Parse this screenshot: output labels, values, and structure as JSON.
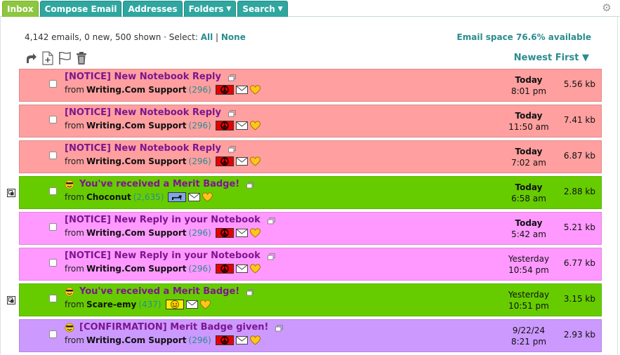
{
  "tabs": [
    {
      "label": "Inbox",
      "active": true,
      "caret": ""
    },
    {
      "label": "Compose Email",
      "active": false,
      "caret": ""
    },
    {
      "label": "Addresses",
      "active": false,
      "caret": ""
    },
    {
      "label": "Folders",
      "active": false,
      "caret": "▼"
    },
    {
      "label": "Search",
      "active": false,
      "caret": "▼"
    }
  ],
  "summary": {
    "counts": "4,142 emails, 0 new, 500 shown · Select: ",
    "select_all": "All",
    "separator": " | ",
    "select_none": "None"
  },
  "space": "Email space 76.6% available",
  "sort": "Newest First ▼",
  "toolbar": [
    "reply-icon",
    "add-to-folder-icon",
    "flag-icon",
    "trash-icon"
  ],
  "messages": [
    {
      "subject": "[NOTICE] New Notebook Reply",
      "sender": "Writing.Com Support",
      "count": "(296)",
      "date": "Today",
      "time": "8:01 pm",
      "size": "5.56 kb",
      "bg": "#ff9f9f",
      "badge": "peace",
      "smiley": false,
      "rowicon": false
    },
    {
      "subject": "[NOTICE] New Notebook Reply",
      "sender": "Writing.Com Support",
      "count": "(296)",
      "date": "Today",
      "time": "11:50 am",
      "size": "7.41 kb",
      "bg": "#ff9f9f",
      "badge": "peace",
      "smiley": false,
      "rowicon": false
    },
    {
      "subject": "[NOTICE] New Notebook Reply",
      "sender": "Writing.Com Support",
      "count": "(296)",
      "date": "Today",
      "time": "7:02 am",
      "size": "6.87 kb",
      "bg": "#ff9f9f",
      "badge": "peace",
      "smiley": false,
      "rowicon": false
    },
    {
      "subject": "You've received a Merit Badge!",
      "sender": "Choconut",
      "count": "(2,635)",
      "date": "Today",
      "time": "6:58 am",
      "size": "2.88 kb",
      "bg": "#66cc00",
      "badge": "dog",
      "smiley": true,
      "rowicon": true
    },
    {
      "subject": "[NOTICE] New Reply in your Notebook",
      "sender": "Writing.Com Support",
      "count": "(296)",
      "date": "Today",
      "time": "5:42 am",
      "size": "5.21 kb",
      "bg": "#ff99ff",
      "badge": "peace",
      "smiley": false,
      "rowicon": false
    },
    {
      "subject": "[NOTICE] New Reply in your Notebook",
      "sender": "Writing.Com Support",
      "count": "(296)",
      "date": "Yesterday",
      "time": "10:54 pm",
      "size": "6.77 kb",
      "bg": "#ff99ff",
      "badge": "peace",
      "smiley": false,
      "rowicon": false
    },
    {
      "subject": "You've received a Merit Badge!",
      "sender": "Scare-emy",
      "count": "(437)",
      "date": "Yesterday",
      "time": "10:51 pm",
      "size": "3.15 kb",
      "bg": "#66cc00",
      "badge": "smile",
      "smiley": true,
      "rowicon": true
    },
    {
      "subject": "[CONFIRMATION] Merit Badge given!",
      "sender": "Writing.Com Support",
      "count": "(296)",
      "date": "9/22/24",
      "time": "8:21 pm",
      "size": "2.93 kb",
      "bg": "#cc99ff",
      "badge": "peace",
      "smiley": true,
      "rowicon": false
    }
  ],
  "from_label": "from",
  "colors": {
    "accent": "#2b8d8f",
    "subject": "#7d1590",
    "tab": "#2fa7a0",
    "tab_active": "#8dc63f"
  }
}
